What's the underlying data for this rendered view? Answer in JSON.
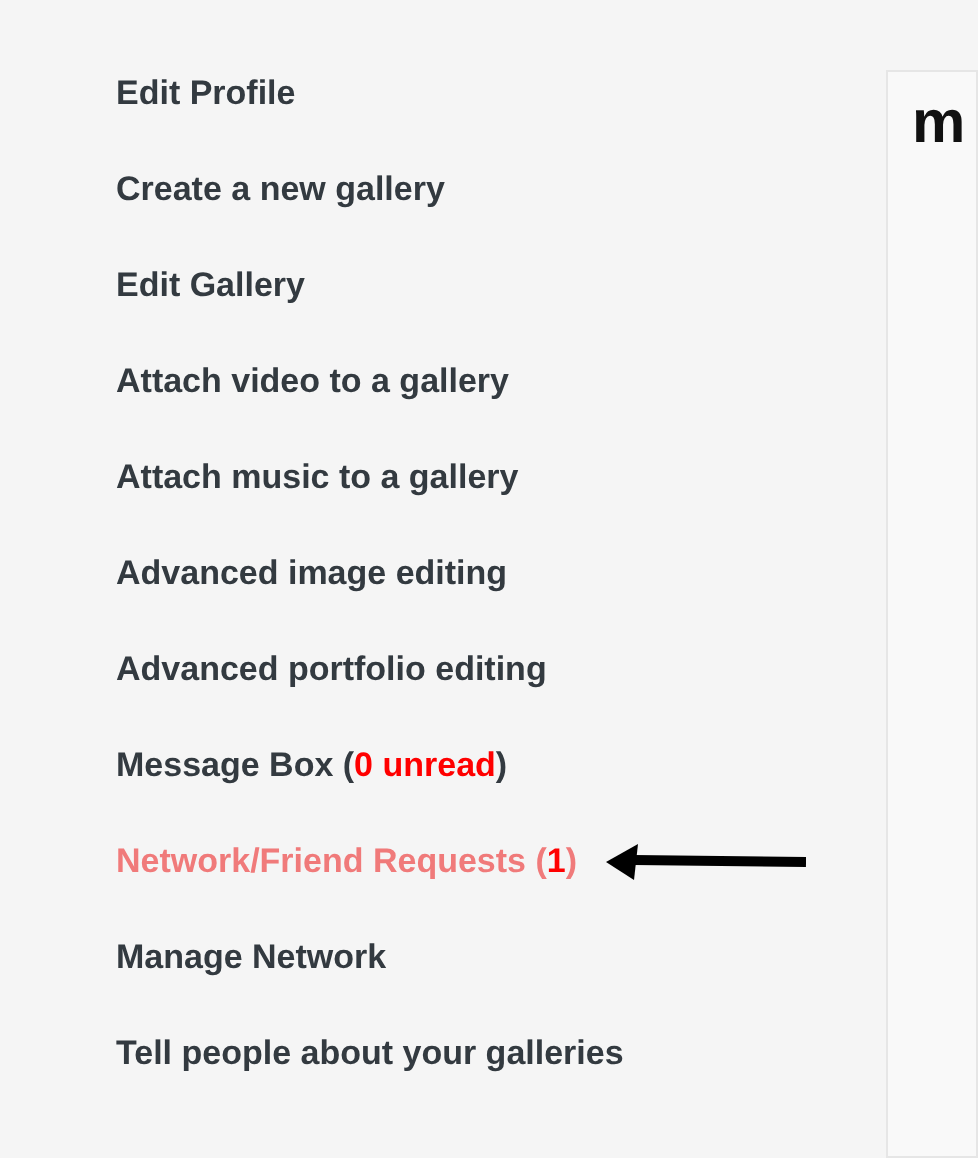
{
  "menu": [
    {
      "label": "Edit Profile",
      "highlighted": false
    },
    {
      "label": "Create a new gallery",
      "highlighted": false
    },
    {
      "label": "Edit Gallery",
      "highlighted": false
    },
    {
      "label": "Attach video to a gallery",
      "highlighted": false
    },
    {
      "label": "Attach music to a gallery",
      "highlighted": false
    },
    {
      "label": "Advanced image editing",
      "highlighted": false
    },
    {
      "label": "Advanced portfolio editing",
      "highlighted": false
    },
    {
      "label": "Message Box (**0 unread**)",
      "highlighted": false
    },
    {
      "label": "Network/Friend Requests (**1**)",
      "highlighted": true
    },
    {
      "label": "Manage Network",
      "highlighted": false
    },
    {
      "label": "Tell people about your galleries",
      "highlighted": false
    }
  ],
  "panel": {
    "heading": "m"
  }
}
